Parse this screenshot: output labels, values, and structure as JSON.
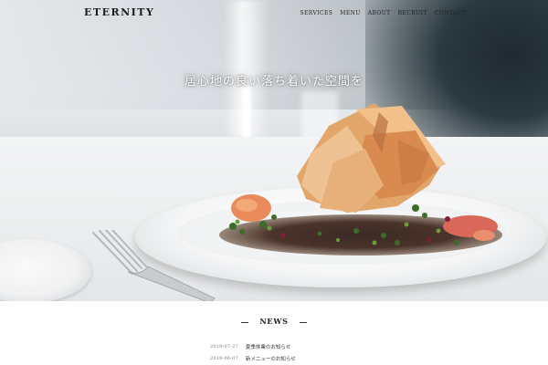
{
  "site": {
    "logo": "ETERNITY"
  },
  "nav": {
    "items": [
      {
        "label": "SERVICES"
      },
      {
        "label": "MENU"
      },
      {
        "label": "ABOUT"
      },
      {
        "label": "RECRUIT"
      },
      {
        "label": "CONTACT"
      }
    ]
  },
  "hero": {
    "tagline": "居心地の良い落ち着いた空間を"
  },
  "news": {
    "title": "NEWS",
    "items": [
      {
        "date": "2019-07-27",
        "text": "夏季休業のお知らせ"
      },
      {
        "date": "2019-06-07",
        "text": "新メニューのお知らせ"
      }
    ]
  }
}
